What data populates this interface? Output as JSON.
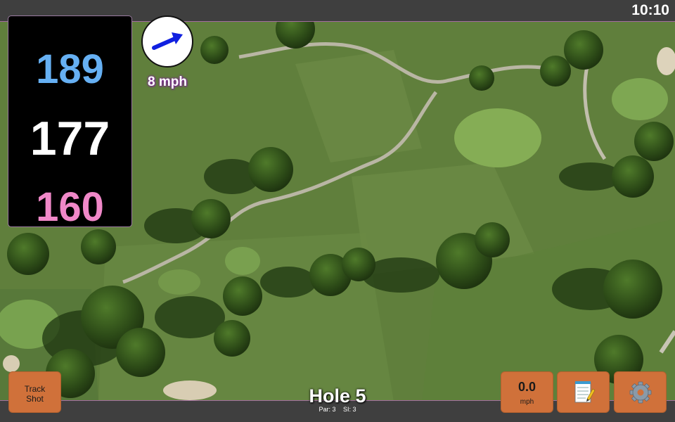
{
  "status": {
    "time": "10:10"
  },
  "distances": {
    "back": "189",
    "middle": "177",
    "front": "160"
  },
  "wind": {
    "speed_label": "8 mph",
    "direction_icon": "arrow-icon"
  },
  "hole": {
    "title": "Hole 5",
    "par": "Par: 3",
    "stroke_index": "SI: 3"
  },
  "buttons": {
    "track_shot_line1": "Track",
    "track_shot_line2": "Shot",
    "speed_value": "0.0",
    "speed_unit": "mph",
    "notes_icon": "notepad-icon",
    "settings_icon": "gear-icon"
  },
  "colors": {
    "back_distance": "#66b0f3",
    "middle_distance": "#ffffff",
    "front_distance": "#f088c8",
    "button_accent": "#d0713a",
    "wind_arrow": "#1020e0"
  }
}
